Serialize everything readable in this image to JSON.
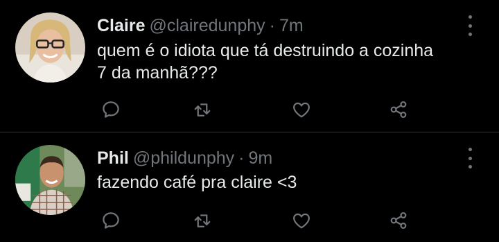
{
  "tweets": [
    {
      "name": "Claire",
      "handle": "@clairedunphy",
      "separator": "·",
      "time": "7m",
      "text_lines": [
        "quem é o idiota que tá destruindo a cozinha",
        "7 da manhã???"
      ]
    },
    {
      "name": "Phil",
      "handle": "@phildunphy",
      "separator": "·",
      "time": "9m",
      "text_lines": [
        "fazendo café pra claire <3"
      ]
    }
  ],
  "icons": {
    "reply": "comment-icon",
    "retweet": "retweet-icon",
    "like": "heart-icon",
    "share": "share-icon",
    "more": "more-vertical-icon"
  },
  "colors": {
    "background": "#000000",
    "text": "#e7e9ea",
    "muted": "#71767b",
    "divider": "#2f3336"
  }
}
